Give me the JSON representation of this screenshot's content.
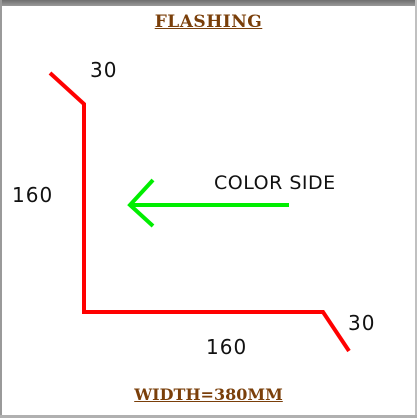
{
  "title": "FLASHING",
  "footer": "WIDTH=380MM",
  "dimensions": {
    "top_flange": "30",
    "vertical_leg": "160",
    "horizontal_leg": "160",
    "end_flange": "30"
  },
  "annotation": "COLOR SIDE",
  "colors": {
    "profile": "#ff0000",
    "arrow": "#00ee00",
    "heading": "#7a3f0a"
  },
  "icons": {
    "direction": "left-arrow-icon"
  }
}
